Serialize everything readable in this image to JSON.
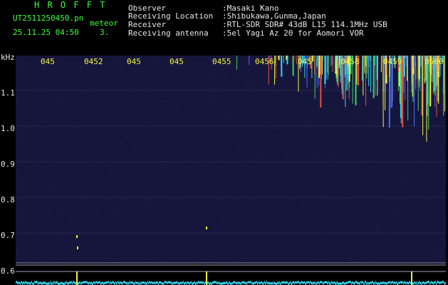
{
  "header": {
    "app_name": "H R O F F T",
    "file_name": "UT2511250450.pn",
    "mode_label": "meteor",
    "datetime": "25.11.25 04:50",
    "counter": "3.",
    "fields": [
      {
        "label": "Observer",
        "value": ":Masaki Kano"
      },
      {
        "label": "Receiving Location",
        "value": ":Shibukawa,Gunma,Japan"
      },
      {
        "label": "Receiver",
        "value": ":RTL-SDR SDR# 43dB L15 114.1MHz USB"
      },
      {
        "label": "Receiving antenna",
        "value": ":5el Yagi Az 20 for Aomori VOR"
      }
    ]
  },
  "y_axis": {
    "unit": "kHz",
    "ticks": [
      "1.1",
      "1.0",
      "0.9",
      "0.8",
      "0.7",
      "0.6"
    ]
  },
  "time_axis": {
    "ticks": [
      "045",
      "0452",
      "045",
      "045",
      "0455",
      "0456",
      "045",
      "0458",
      "0459",
      "0500"
    ]
  },
  "colors": {
    "background": "#000000",
    "plot_background": "#16163c",
    "header_green": "#3cff3c",
    "header_white": "#e8e8e8",
    "axis_yellow": "#f3f33c",
    "signal_cyan": "#2fd6ee",
    "signal_yellow": "#f3f33c",
    "signal_red": "#e05040"
  }
}
